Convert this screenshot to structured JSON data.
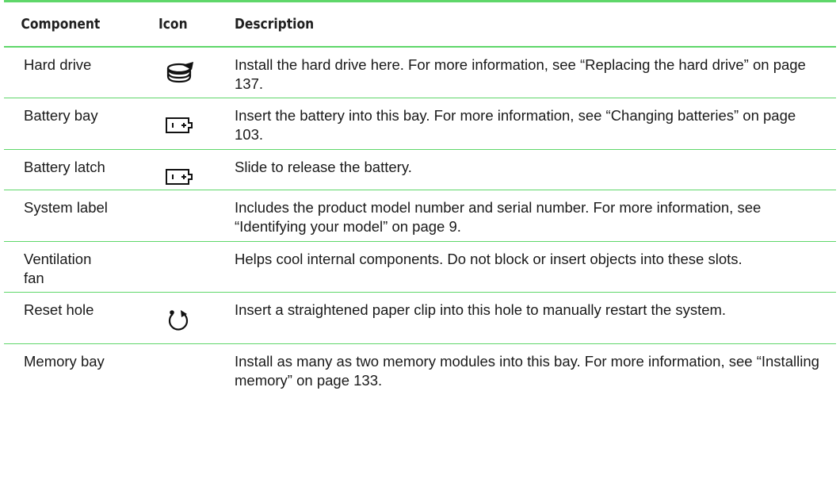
{
  "headers": {
    "component": "Component",
    "icon": "Icon",
    "description": "Description"
  },
  "rows": [
    {
      "component": "Hard drive",
      "icon": "hard-drive-icon",
      "description": "Install the hard drive here. For more information, see “Replacing the hard drive” on page 137."
    },
    {
      "component": "Battery bay",
      "icon": "battery-icon",
      "description": "Insert the battery into this bay. For more information, see “Changing batteries” on page 103."
    },
    {
      "component": "Battery latch",
      "icon": "battery-icon",
      "description": "Slide to release the battery."
    },
    {
      "component": "System label",
      "icon": "",
      "description": "Includes the product model number and serial number. For more information, see “Identifying your model” on page 9."
    },
    {
      "component": "Ventilation fan",
      "icon": "",
      "description": "Helps cool internal components. Do not block or insert objects into these slots."
    },
    {
      "component": "Reset hole",
      "icon": "reset-icon",
      "description": "Insert a straightened paper clip into this hole to manually restart the system."
    },
    {
      "component": "Memory bay",
      "icon": "",
      "description": "Install as many as two memory modules into this bay. For more information, see “Installing memory” on page 133."
    }
  ],
  "colors": {
    "rule": "#5fd76a",
    "text": "#1a1a1a"
  }
}
